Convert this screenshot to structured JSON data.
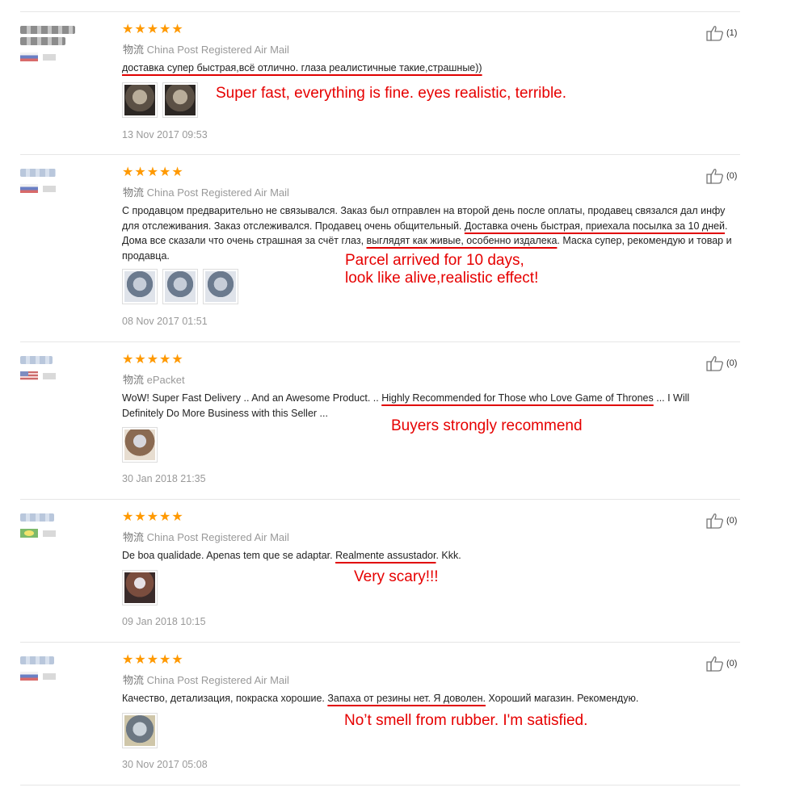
{
  "reviews": [
    {
      "stars": "★★★★★",
      "ship_cn": "物流",
      "ship": "China Post Registered Air Mail",
      "text_parts": [
        "доставка супер быстрая,всё отлично. глаза реалистичные такие,страшные))"
      ],
      "annotation": [
        "Super fast, everything is fine. eyes realistic, terrible."
      ],
      "date": "13 Nov 2017 09:53",
      "likes": "(1)"
    },
    {
      "stars": "★★★★★",
      "ship_cn": "物流",
      "ship": "China Post Registered Air Mail",
      "text_parts": [
        "С продавцом предварительно не связывался. Заказ был отправлен на второй день после оплаты, продавец связался дал инфу для отслеживания. Заказ отслеживался. Продавец очень общительный. ",
        "Доставка очень быстрая, приехала посылка за 10 дней",
        ". Дома все сказали что очень страшная за счёт глаз, ",
        "выглядят как живые, особенно издалека",
        ". Маска супер, рекомендую и товар и продавца."
      ],
      "annotation": [
        "Parcel arrived for 10 days,",
        "look like alive,realistic effect!"
      ],
      "date": "08 Nov 2017 01:51",
      "likes": "(0)"
    },
    {
      "stars": "★★★★★",
      "ship_cn": "物流",
      "ship": "ePacket",
      "text_parts": [
        "WoW! Super Fast Delivery .. And an Awesome Product. .. ",
        "Highly Recommended for Those who Love Game of Thrones",
        " ... I Will Definitely Do More Business with this Seller ..."
      ],
      "annotation": [
        "Buyers strongly recommend"
      ],
      "date": "30 Jan 2018 21:35",
      "likes": "(0)"
    },
    {
      "stars": "★★★★★",
      "ship_cn": "物流",
      "ship": "China Post Registered Air Mail",
      "text_parts": [
        "De boa qualidade. Apenas tem que se adaptar. ",
        "Realmente assustador",
        ". Kkk."
      ],
      "annotation": [
        "Very scary!!!"
      ],
      "date": "09 Jan 2018 10:15",
      "likes": "(0)"
    },
    {
      "stars": "★★★★★",
      "ship_cn": "物流",
      "ship": "China Post Registered Air Mail",
      "text_parts": [
        "Качество, детализация, покраска хорошие. ",
        "Запаха от резины нет. Я доволен.",
        " Хороший магазин. Рекомендую."
      ],
      "annotation": [
        "No’t smell from rubber. I'm satisfied."
      ],
      "date": "30 Nov 2017 05:08",
      "likes": "(0)"
    }
  ],
  "icons": {
    "like": "thumbs-up-icon",
    "rating": "star-icon",
    "flag": "country-flag-icon"
  },
  "colors": {
    "star": "#ff9900",
    "annotation": "#e60000",
    "underline": "#e00000",
    "muted": "#999999"
  }
}
